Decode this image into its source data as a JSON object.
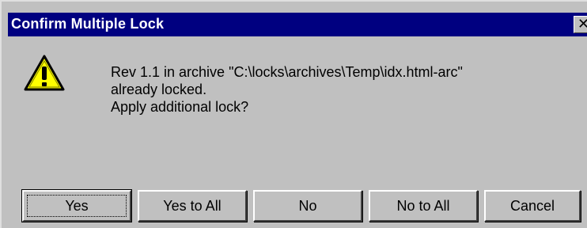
{
  "window": {
    "title": "Confirm Multiple Lock",
    "close_label": "✕"
  },
  "dialog": {
    "icon": "warning-icon",
    "message_lines": [
      "Rev 1.1 in archive \"C:\\locks\\archives\\Temp\\idx.html-arc\"",
      "already locked.",
      "Apply additional lock?"
    ]
  },
  "buttons": {
    "yes": "Yes",
    "yes_to_all": "Yes to All",
    "no": "No",
    "no_to_all": "No to All",
    "cancel": "Cancel"
  },
  "colors": {
    "titlebar": "#000080",
    "face": "#c0c0c0",
    "warning_fill": "#ffff00"
  }
}
